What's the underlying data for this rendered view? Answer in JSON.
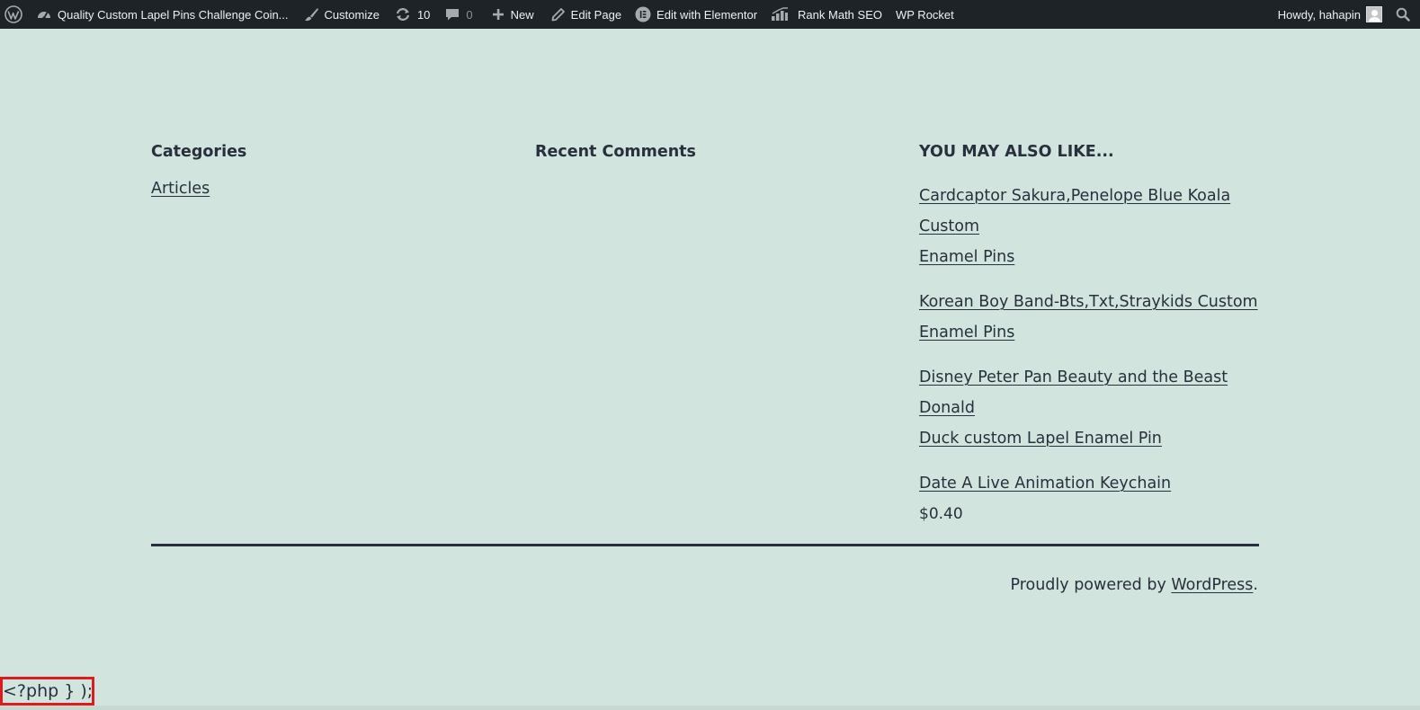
{
  "adminbar": {
    "site_name": "Quality Custom Lapel Pins Challenge Coin...",
    "customize": "Customize",
    "updates_count": "10",
    "comments_count": "0",
    "new": "New",
    "edit_page": "Edit Page",
    "edit_elementor": "Edit with Elementor",
    "rank_math": "Rank Math SEO",
    "wp_rocket": "WP Rocket",
    "howdy": "Howdy, hahapin",
    "icons": [
      "wordpress-logo-icon",
      "dashboard-icon",
      "brush-icon",
      "updates-icon",
      "comment-icon",
      "plus-icon",
      "pencil-icon",
      "elementor-icon",
      "rank-math-icon",
      "avatar-icon",
      "search-icon"
    ]
  },
  "widgets": {
    "categories": {
      "title": "Categories",
      "items": [
        "Articles"
      ]
    },
    "recent_comments": {
      "title": "Recent Comments"
    },
    "also_like": {
      "title": "YOU MAY ALSO LIKE...",
      "products": [
        {
          "line1": "Cardcaptor Sakura,Penelope Blue Koala Custom",
          "line2": "Enamel Pins"
        },
        {
          "line1": "Korean Boy Band-Bts,Txt,Straykids Custom",
          "line2": "Enamel Pins"
        },
        {
          "line1": "Disney Peter Pan Beauty and the Beast Donald",
          "line2": "Duck custom Lapel Enamel Pin"
        },
        {
          "line1": "Date A Live Animation Keychain",
          "price": "$0.40"
        }
      ]
    }
  },
  "footer": {
    "powered_prefix": "Proudly powered by ",
    "powered_link": "WordPress",
    "powered_suffix": "."
  },
  "stray_code": "<?php } );",
  "colors": {
    "background": "#d1e4dd",
    "adminbar": "#1d2327",
    "text": "#28303d",
    "highlight_box": "#e01b1b"
  }
}
